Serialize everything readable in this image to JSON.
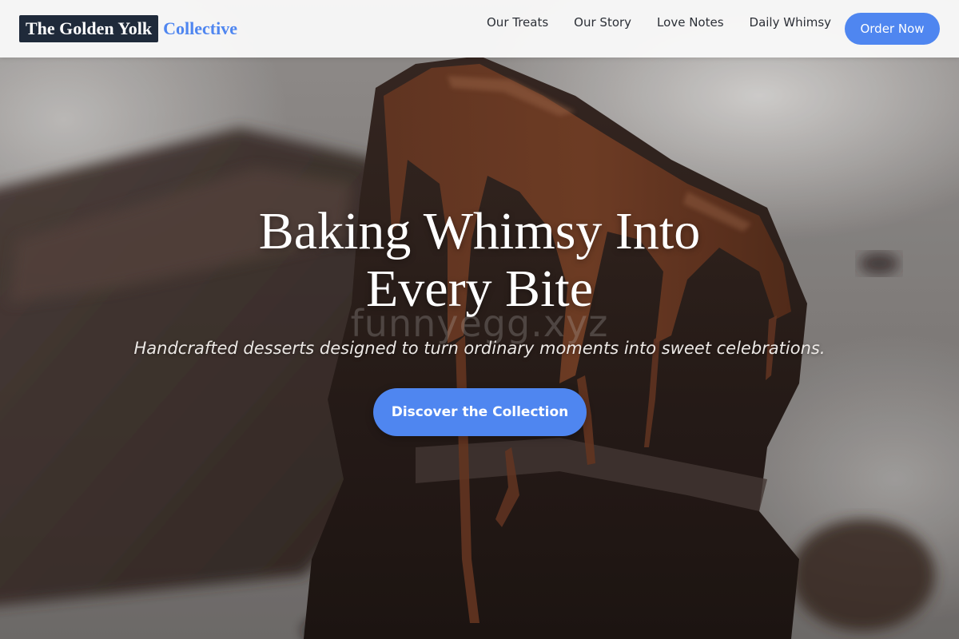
{
  "brand": {
    "name_main": "The Golden Yolk",
    "name_accent": "Collective",
    "colors": {
      "accent": "#4f86f0",
      "logo_bg": "#1f2a3a"
    }
  },
  "nav": {
    "items": [
      {
        "label": "Our Treats"
      },
      {
        "label": "Our Story"
      },
      {
        "label": "Love Notes"
      },
      {
        "label": "Daily Whimsy"
      }
    ],
    "order_label": "Order Now"
  },
  "hero": {
    "title_line1": "Baking Whimsy Into",
    "title_line2": "Every Bite",
    "watermark": "funnyegg.xyz",
    "subtitle": "Handcrafted desserts designed to turn ordinary moments into sweet celebrations.",
    "cta_label": "Discover the Collection",
    "background_image": "chocolate-cake-photo"
  }
}
